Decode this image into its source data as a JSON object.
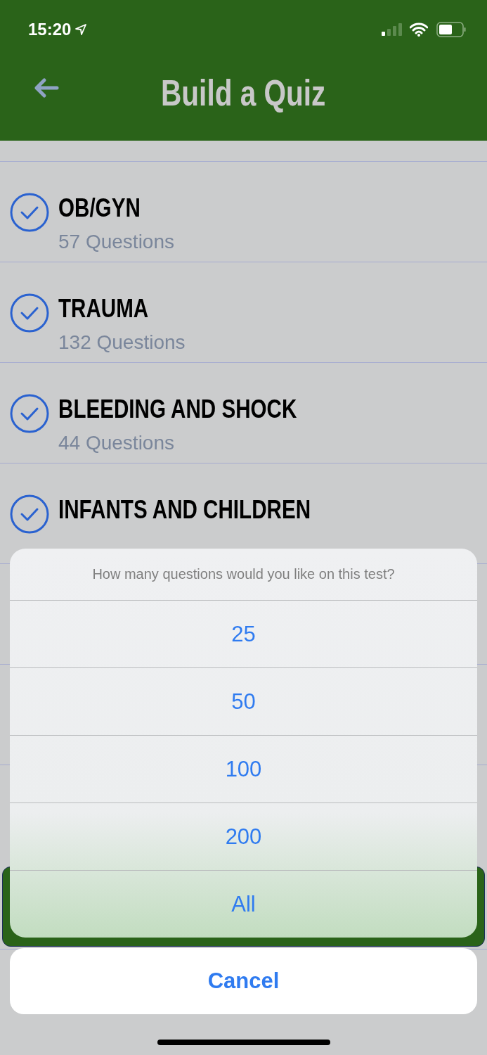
{
  "status_bar": {
    "time": "15:20"
  },
  "header": {
    "title": "Build a Quiz"
  },
  "categories": [
    {
      "name": "OB/GYN",
      "count": "57 Questions",
      "checked": true
    },
    {
      "name": "TRAUMA",
      "count": "132 Questions",
      "checked": true
    },
    {
      "name": "BLEEDING AND SHOCK",
      "count": "44 Questions",
      "checked": true
    },
    {
      "name": "INFANTS AND CHILDREN",
      "checked": true
    }
  ],
  "action_sheet": {
    "message": "How many questions would you like on this test?",
    "options": [
      "25",
      "50",
      "100",
      "200",
      "All"
    ],
    "cancel": "Cancel"
  }
}
